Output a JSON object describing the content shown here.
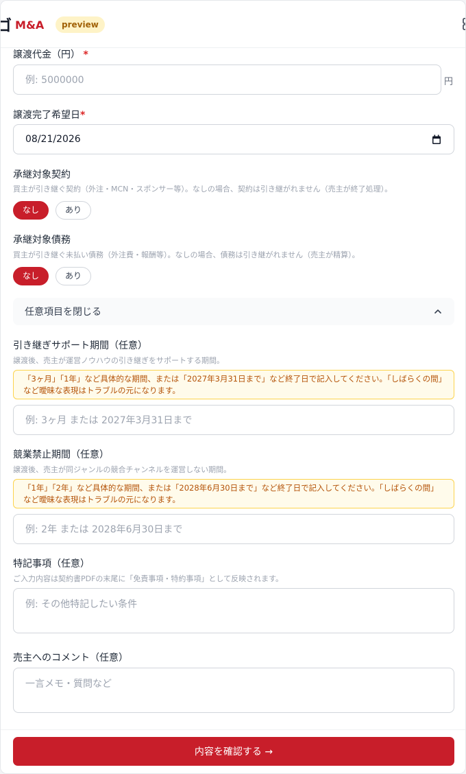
{
  "header": {
    "logo_mark": "ゴ",
    "logo_text": "M&A",
    "badge": "preview"
  },
  "form": {
    "price": {
      "label": "譲渡代金（円）",
      "required_mark": "*",
      "placeholder": "例: 5000000",
      "unit": "円"
    },
    "completion_date": {
      "label": "譲渡完了希望日",
      "required_mark": "*",
      "value": "08/21/2026"
    },
    "contracts": {
      "label": "承継対象契約",
      "hint": "買主が引き継ぐ契約（外注・MCN・スポンサー等）。なしの場合、契約は引き継がれません（売主が終了処理）。",
      "options": [
        "なし",
        "あり"
      ],
      "selected": "なし"
    },
    "debts": {
      "label": "承継対象債務",
      "hint": "買主が引き継ぐ未払い債務（外注費・報酬等）。なしの場合、債務は引き継がれません（売主が精算）。",
      "options": [
        "なし",
        "あり"
      ],
      "selected": "なし"
    },
    "optional_toggle": "任意項目を閉じる",
    "support_period": {
      "label": "引き継ぎサポート期間（任意）",
      "hint": "譲渡後、売主が運営ノウハウの引き継ぎをサポートする期間。",
      "warning": "「3ヶ月」「1年」など具体的な期間、または「2027年3月31日まで」など終了日で記入してください。「しばらくの間」など曖昧な表現はトラブルの元になります。",
      "placeholder": "例: 3ヶ月 または 2027年3月31日まで"
    },
    "non_compete": {
      "label": "競業禁止期間（任意）",
      "hint": "譲渡後、売主が同ジャンルの競合チャンネルを運営しない期間。",
      "warning": "「1年」「2年」など具体的な期間、または「2028年6月30日まで」など終了日で記入してください。「しばらくの間」など曖昧な表現はトラブルの元になります。",
      "placeholder": "例: 2年 または 2028年6月30日まで"
    },
    "special_notes": {
      "label": "特記事項（任意）",
      "hint": "ご入力内容は契約書PDFの末尾に「免責事項・特約事項」として反映されます。",
      "placeholder": "例: その他特記したい条件"
    },
    "comment": {
      "label": "売主へのコメント（任意）",
      "placeholder": "一言メモ・質問など"
    }
  },
  "footer": {
    "submit_label": "内容を確認する →"
  },
  "colors": {
    "brand": "#c81e2a",
    "badge_bg": "#fef3c7",
    "warning_bg": "#fffbeb",
    "warning_border": "#fcd34d",
    "warning_text": "#b45309"
  }
}
